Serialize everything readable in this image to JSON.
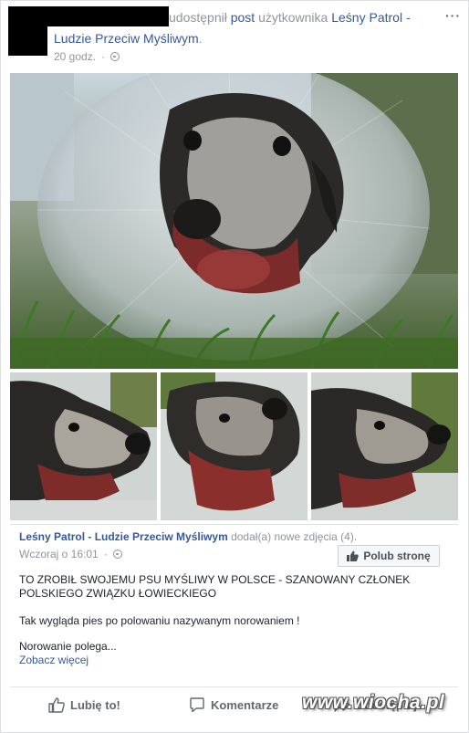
{
  "post": {
    "action_text": "udostępnił",
    "post_link": "post",
    "of_user_text": "użytkownika",
    "page_name_part1": "Leśny Patrol -",
    "page_name_part2": "Ludzie Przeciw Myśliwym",
    "page_name_suffix": ".",
    "time": "20 godz.",
    "privacy_icon": "globe-icon",
    "more_label": "···"
  },
  "shared": {
    "author": "Leśny Patrol - Ludzie Przeciw Myśliwym",
    "author_action": "dodał(a) nowe zdjęcia (4).",
    "time": "Wczoraj o 16:01",
    "dot": "·",
    "privacy_icon": "globe-icon",
    "like_page_label": "Polub stronę",
    "text_1": "TO ZROBIŁ SWOJEMU PSU MYŚLIWY W POLSCE - SZANOWANY CZŁONEK POLSKIEGO ZWIĄZKU ŁOWIECKIEGO",
    "text_2": "Tak wygląda pies po polowaniu nazywanym norowaniem !",
    "text_3": "Norowanie polega...",
    "see_more": "Zobacz więcej"
  },
  "actions": {
    "like": "Lubię to!",
    "comment": "Komentarze",
    "share": "Udostępnij"
  },
  "watermark": "www.wiocha.pl",
  "colors": {
    "link": "#365899",
    "meta_grey": "#90949c",
    "action_grey": "#606770"
  }
}
